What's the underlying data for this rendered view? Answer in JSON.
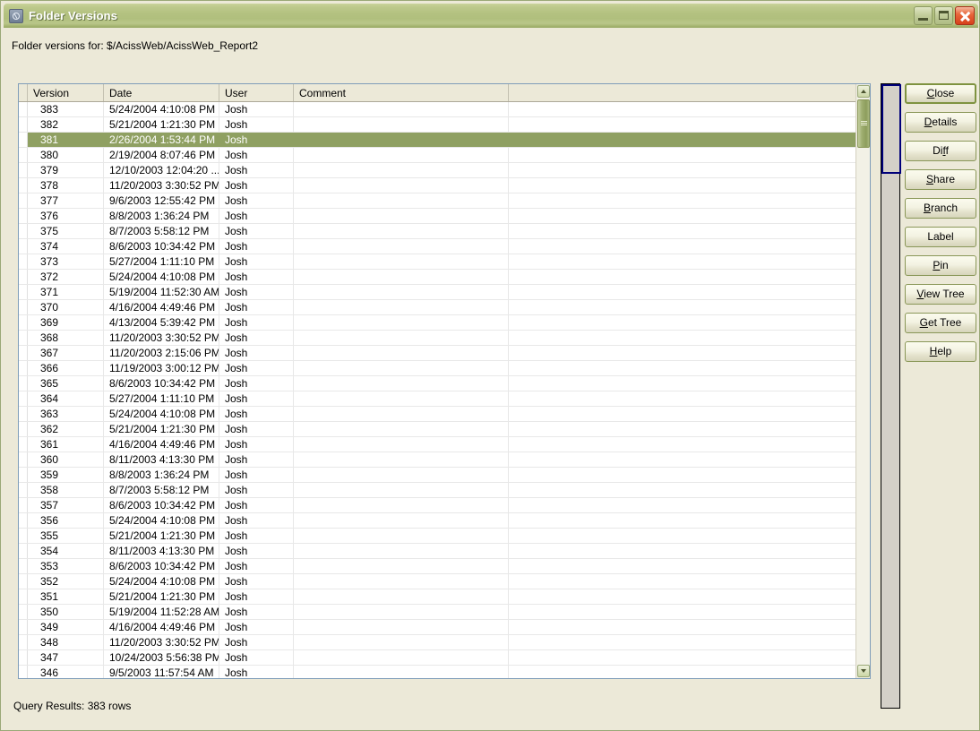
{
  "window": {
    "title": "Folder Versions",
    "icon": "app-icon",
    "controls": {
      "minimize": "minimize-button",
      "maximize": "maximize-button",
      "close": "close-button"
    }
  },
  "header": {
    "folder_label": "Folder versions for: $/AcissWeb/AcissWeb_Report2"
  },
  "grid": {
    "columns": [
      "Version",
      "Date",
      "User",
      "Comment"
    ],
    "selected_version": "381",
    "rows": [
      {
        "version": "383",
        "date": "5/24/2004 4:10:08 PM",
        "user": "Josh",
        "comment": ""
      },
      {
        "version": "382",
        "date": "5/21/2004 1:21:30 PM",
        "user": "Josh",
        "comment": ""
      },
      {
        "version": "381",
        "date": "2/26/2004 1:53:44 PM",
        "user": "Josh",
        "comment": ""
      },
      {
        "version": "380",
        "date": "2/19/2004 8:07:46 PM",
        "user": "Josh",
        "comment": ""
      },
      {
        "version": "379",
        "date": "12/10/2003 12:04:20 ...",
        "user": "Josh",
        "comment": ""
      },
      {
        "version": "378",
        "date": "11/20/2003 3:30:52 PM",
        "user": "Josh",
        "comment": ""
      },
      {
        "version": "377",
        "date": "9/6/2003 12:55:42 PM",
        "user": "Josh",
        "comment": ""
      },
      {
        "version": "376",
        "date": "8/8/2003 1:36:24 PM",
        "user": "Josh",
        "comment": ""
      },
      {
        "version": "375",
        "date": "8/7/2003 5:58:12 PM",
        "user": "Josh",
        "comment": ""
      },
      {
        "version": "374",
        "date": "8/6/2003 10:34:42 PM",
        "user": "Josh",
        "comment": ""
      },
      {
        "version": "373",
        "date": "5/27/2004 1:11:10 PM",
        "user": "Josh",
        "comment": ""
      },
      {
        "version": "372",
        "date": "5/24/2004 4:10:08 PM",
        "user": "Josh",
        "comment": ""
      },
      {
        "version": "371",
        "date": "5/19/2004 11:52:30 AM",
        "user": "Josh",
        "comment": ""
      },
      {
        "version": "370",
        "date": "4/16/2004 4:49:46 PM",
        "user": "Josh",
        "comment": ""
      },
      {
        "version": "369",
        "date": "4/13/2004 5:39:42 PM",
        "user": "Josh",
        "comment": ""
      },
      {
        "version": "368",
        "date": "11/20/2003 3:30:52 PM",
        "user": "Josh",
        "comment": ""
      },
      {
        "version": "367",
        "date": "11/20/2003 2:15:06 PM",
        "user": "Josh",
        "comment": ""
      },
      {
        "version": "366",
        "date": "11/19/2003 3:00:12 PM",
        "user": "Josh",
        "comment": ""
      },
      {
        "version": "365",
        "date": "8/6/2003 10:34:42 PM",
        "user": "Josh",
        "comment": ""
      },
      {
        "version": "364",
        "date": "5/27/2004 1:11:10 PM",
        "user": "Josh",
        "comment": ""
      },
      {
        "version": "363",
        "date": "5/24/2004 4:10:08 PM",
        "user": "Josh",
        "comment": ""
      },
      {
        "version": "362",
        "date": "5/21/2004 1:21:30 PM",
        "user": "Josh",
        "comment": ""
      },
      {
        "version": "361",
        "date": "4/16/2004 4:49:46 PM",
        "user": "Josh",
        "comment": ""
      },
      {
        "version": "360",
        "date": "8/11/2003 4:13:30 PM",
        "user": "Josh",
        "comment": ""
      },
      {
        "version": "359",
        "date": "8/8/2003 1:36:24 PM",
        "user": "Josh",
        "comment": ""
      },
      {
        "version": "358",
        "date": "8/7/2003 5:58:12 PM",
        "user": "Josh",
        "comment": ""
      },
      {
        "version": "357",
        "date": "8/6/2003 10:34:42 PM",
        "user": "Josh",
        "comment": ""
      },
      {
        "version": "356",
        "date": "5/24/2004 4:10:08 PM",
        "user": "Josh",
        "comment": ""
      },
      {
        "version": "355",
        "date": "5/21/2004 1:21:30 PM",
        "user": "Josh",
        "comment": ""
      },
      {
        "version": "354",
        "date": "8/11/2003 4:13:30 PM",
        "user": "Josh",
        "comment": ""
      },
      {
        "version": "353",
        "date": "8/6/2003 10:34:42 PM",
        "user": "Josh",
        "comment": ""
      },
      {
        "version": "352",
        "date": "5/24/2004 4:10:08 PM",
        "user": "Josh",
        "comment": ""
      },
      {
        "version": "351",
        "date": "5/21/2004 1:21:30 PM",
        "user": "Josh",
        "comment": ""
      },
      {
        "version": "350",
        "date": "5/19/2004 11:52:28 AM",
        "user": "Josh",
        "comment": ""
      },
      {
        "version": "349",
        "date": "4/16/2004 4:49:46 PM",
        "user": "Josh",
        "comment": ""
      },
      {
        "version": "348",
        "date": "11/20/2003 3:30:52 PM",
        "user": "Josh",
        "comment": ""
      },
      {
        "version": "347",
        "date": "10/24/2003 5:56:38 PM",
        "user": "Josh",
        "comment": ""
      },
      {
        "version": "346",
        "date": "9/5/2003 11:57:54 AM",
        "user": "Josh",
        "comment": ""
      }
    ]
  },
  "scrollbar": {
    "up_arrow": "scroll-up-arrow",
    "down_arrow": "scroll-down-arrow"
  },
  "buttons": [
    {
      "label": "Close",
      "accel": "C",
      "focused": true
    },
    {
      "label": "Details",
      "accel": "D",
      "focused": false
    },
    {
      "label": "Diff",
      "accel": "f",
      "focused": false
    },
    {
      "label": "Share",
      "accel": "S",
      "focused": false
    },
    {
      "label": "Branch",
      "accel": "B",
      "focused": false
    },
    {
      "label": "Label",
      "accel": "",
      "focused": false
    },
    {
      "label": "Pin",
      "accel": "P",
      "focused": false
    },
    {
      "label": "View Tree",
      "accel": "V",
      "focused": false
    },
    {
      "label": "Get Tree",
      "accel": "G",
      "focused": false
    },
    {
      "label": "Help",
      "accel": "H",
      "focused": false
    }
  ],
  "status": {
    "text": "Query Results: 383 rows"
  },
  "colors": {
    "titlebar": "#b4c281",
    "dialog_face": "#ece9d8",
    "selection": "#8fa062",
    "splitter_focus": "#00007a",
    "close_button": "#d6401a"
  }
}
